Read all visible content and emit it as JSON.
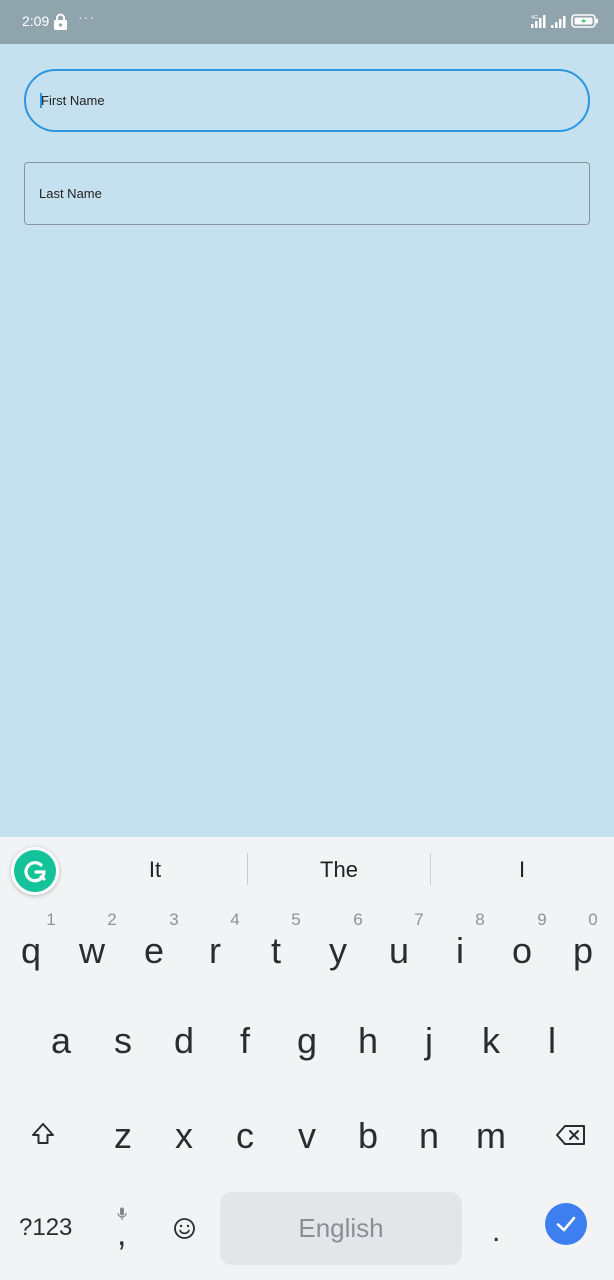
{
  "status_bar": {
    "time": "2:09",
    "dots": "···",
    "icons": [
      "lock-icon",
      "signal-icon",
      "signal-icon",
      "battery-icon"
    ]
  },
  "form": {
    "first_name_placeholder": "First Name",
    "last_name_placeholder": "Last Name",
    "focus_color": "#2b95e0"
  },
  "keyboard": {
    "suggestions": [
      "It",
      "The",
      "I"
    ],
    "row1": [
      {
        "letter": "q",
        "hint": "1"
      },
      {
        "letter": "w",
        "hint": "2"
      },
      {
        "letter": "e",
        "hint": "3"
      },
      {
        "letter": "r",
        "hint": "4"
      },
      {
        "letter": "t",
        "hint": "5"
      },
      {
        "letter": "y",
        "hint": "6"
      },
      {
        "letter": "u",
        "hint": "7"
      },
      {
        "letter": "i",
        "hint": "8"
      },
      {
        "letter": "o",
        "hint": "9"
      },
      {
        "letter": "p",
        "hint": "0"
      }
    ],
    "row2": [
      "a",
      "s",
      "d",
      "f",
      "g",
      "h",
      "j",
      "k",
      "l"
    ],
    "row3": [
      "z",
      "x",
      "c",
      "v",
      "b",
      "n",
      "m"
    ],
    "symbols_label": "?123",
    "comma": ",",
    "period": ".",
    "space_label": "English",
    "accent_color": "#3d7ef0",
    "grammarly_color": "#15c39a"
  }
}
